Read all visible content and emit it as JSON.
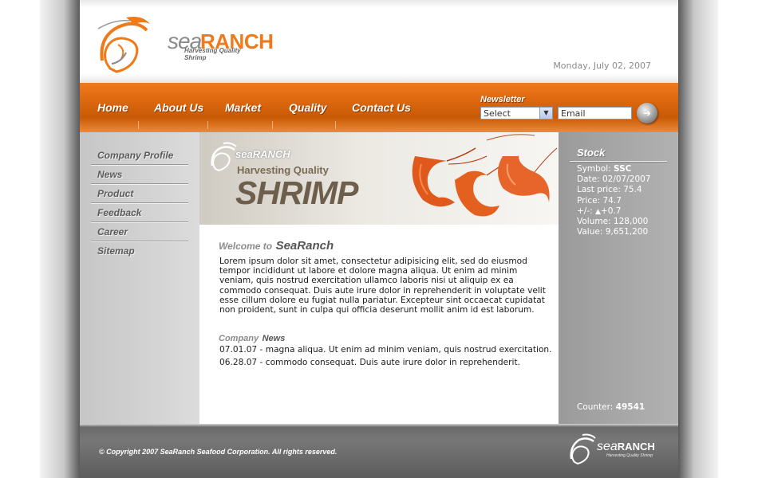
{
  "header": {
    "logo_sea": "sea",
    "logo_ranch": "RANCH",
    "logo_tagline": "Harvesting Quality Shrimp",
    "date": "Monday, July 02, 2007"
  },
  "nav": {
    "items": [
      {
        "label": "Home"
      },
      {
        "label": "About Us"
      },
      {
        "label": "Market"
      },
      {
        "label": "Quality"
      },
      {
        "label": "Contact Us"
      }
    ],
    "newsletter_label": "Newsletter",
    "select_value": "Select",
    "email_value": "Email"
  },
  "sidebar": {
    "items": [
      {
        "label": "Company Profile"
      },
      {
        "label": "News"
      },
      {
        "label": "Product"
      },
      {
        "label": "Feedback"
      },
      {
        "label": "Career"
      },
      {
        "label": "Sitemap"
      }
    ]
  },
  "banner": {
    "logo_text": "seaRANCH",
    "subtitle": "Harvesting Quality",
    "big": "SHRIMP"
  },
  "welcome": {
    "title_a": "Welcome to",
    "title_b": "SeaRanch",
    "body": "Lorem ipsum dolor sit amet, consectetur adipisicing elit, sed do eiusmod tempor incididunt ut labore et dolore magna aliqua. Ut enim ad minim veniam, quis nostrud exercitation ullamco laboris nisi ut aliquip ex ea commodo consequat. Duis aute irure dolor in reprehenderit in voluptate velit esse cillum dolore eu fugiat nulla pariatur. Excepteur sint occaecat cupidatat non proident, sunt in culpa qui officia deserunt mollit anim id est laborum."
  },
  "news": {
    "title_a": "Company",
    "title_b": "News",
    "items": [
      {
        "date": "07.01.07",
        "text": " - magna aliqua. Ut enim ad minim veniam, quis nostrud exercitation."
      },
      {
        "date": "06.28.07",
        "text": " - commodo consequat. Duis aute irure dolor in reprehenderit."
      }
    ]
  },
  "stock": {
    "title": "Stock",
    "symbol_label": "Symbol: ",
    "symbol": "SSC",
    "date": "Date: 02/07/2007",
    "last_price": "Last price: 75.4",
    "price": "Price: 74.7",
    "change_label": "+/-: ",
    "change": "+0.7",
    "volume": "Volume: 128,000",
    "value": "Value: 9,651,200",
    "counter_label": "Counter: ",
    "counter": "49541"
  },
  "footer": {
    "copyright": "© Copyright 2007   SeaRanch Seafood Corporation. All rights reserved.",
    "logo_sea": "sea",
    "logo_ranch": "RANCH",
    "logo_tag": "Harvesting Quality Shrimp"
  },
  "colors": {
    "accent": "#ef7a1a",
    "nav": "#d9650c",
    "sidebar": "#cfcfcf",
    "stock_panel": "#a3a3a3",
    "footer": "#6e6e6e"
  }
}
